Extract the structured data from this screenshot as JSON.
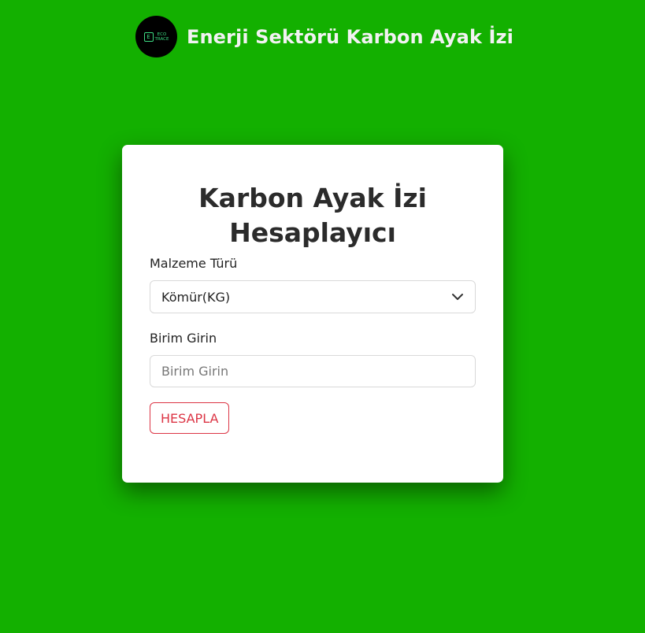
{
  "header": {
    "logo_text": "ECO\nTRACE",
    "logo_icon": "eco-trace-logo",
    "title": "Enerji Sektörü Karbon Ayak İzi"
  },
  "card": {
    "title_line1": "Karbon Ayak İzi",
    "title_line2": "Hesaplayıcı",
    "material_label": "Malzeme Türü",
    "material_selected": "Kömür(KG)",
    "unit_label": "Birim Girin",
    "unit_placeholder": "Birim Girin",
    "unit_value": "",
    "calculate_button": "HESAPLA"
  },
  "colors": {
    "background": "#13b000",
    "card": "#ffffff",
    "button_accent": "#dc3545",
    "logo_accent": "#3ddc84"
  }
}
